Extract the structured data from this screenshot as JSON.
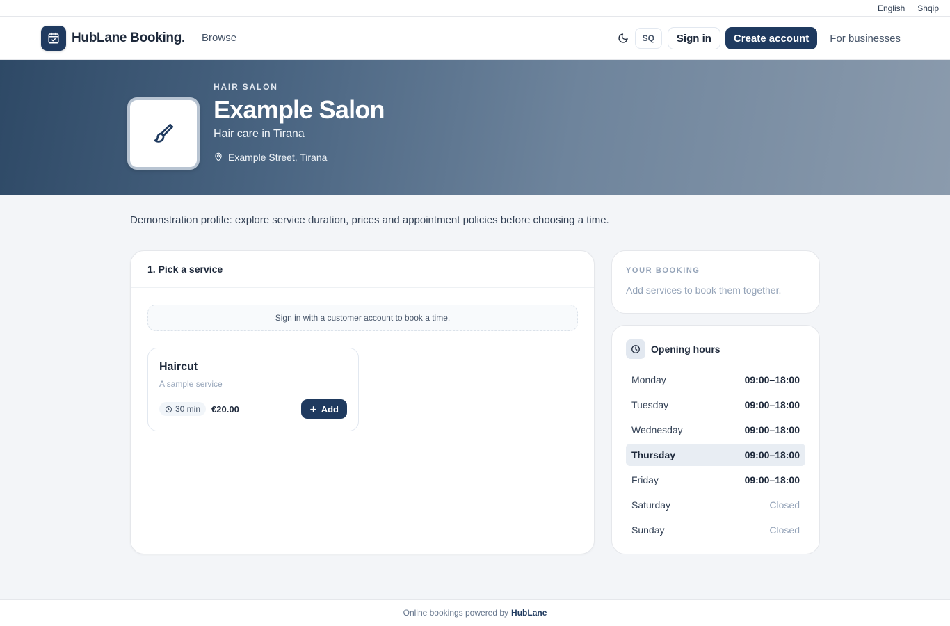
{
  "lang_bar": {
    "english": "English",
    "albanian": "Shqip"
  },
  "header": {
    "brand": "HubLane Booking.",
    "browse": "Browse",
    "lang_toggle": "SQ",
    "sign_in": "Sign in",
    "create_account": "Create account",
    "for_businesses": "For businesses"
  },
  "hero": {
    "category": "HAIR SALON",
    "title": "Example Salon",
    "subtitle": "Hair care in Tirana",
    "address": "Example Street, Tirana"
  },
  "demo_note": "Demonstration profile: explore service duration, prices and appointment policies before choosing a time.",
  "services": {
    "heading": "1. Pick a service",
    "signin_notice": "Sign in with a customer account to book a time.",
    "items": [
      {
        "name": "Haircut",
        "description": "A sample service",
        "duration": "30 min",
        "price": "€20.00",
        "add_label": "Add"
      }
    ]
  },
  "booking": {
    "title": "YOUR BOOKING",
    "empty": "Add services to book them together."
  },
  "hours": {
    "title": "Opening hours",
    "days": [
      {
        "day": "Monday",
        "time": "09:00–18:00"
      },
      {
        "day": "Tuesday",
        "time": "09:00–18:00"
      },
      {
        "day": "Wednesday",
        "time": "09:00–18:00"
      },
      {
        "day": "Thursday",
        "time": "09:00–18:00"
      },
      {
        "day": "Friday",
        "time": "09:00–18:00"
      },
      {
        "day": "Saturday",
        "time": "Closed"
      },
      {
        "day": "Sunday",
        "time": "Closed"
      }
    ]
  },
  "footer": {
    "text": "Online bookings powered by",
    "brand": "HubLane"
  },
  "colors": {
    "brand": "#1f3a5f",
    "today_highlight": "#e8edf3"
  }
}
